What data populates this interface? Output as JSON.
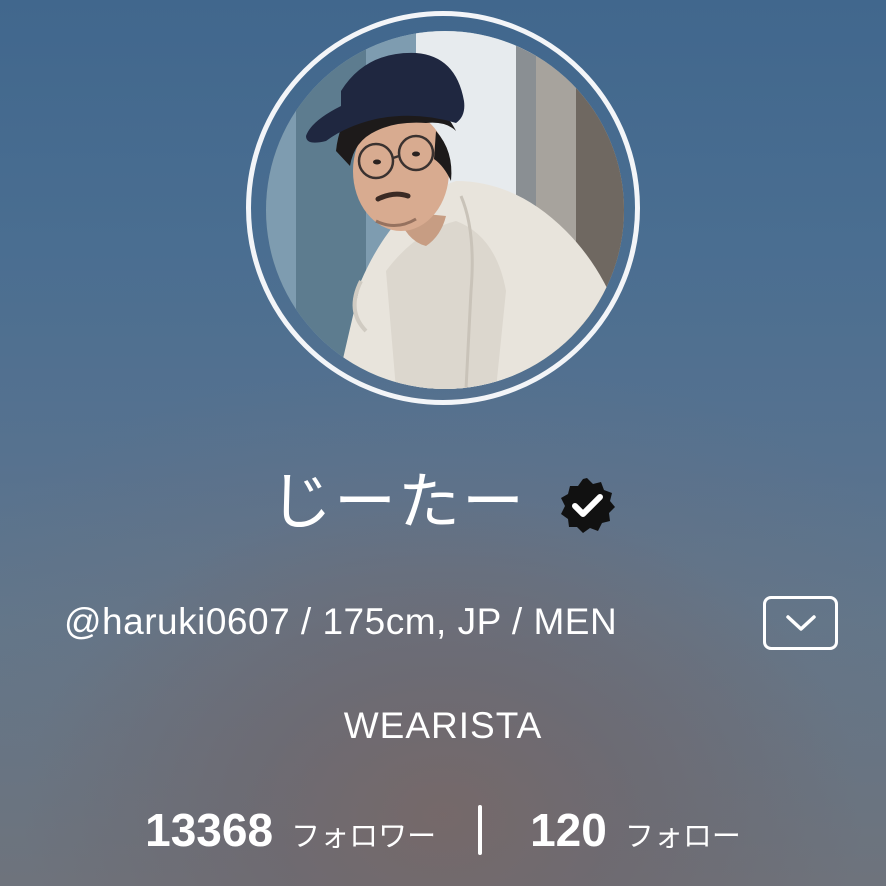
{
  "profile": {
    "display_name": "じーたー",
    "verified_icon": "verified-check-badge",
    "meta_line": "@haruki0607 / 175cm, JP / MEN",
    "expand_icon": "chevron-down-icon",
    "role": "WEARISTA"
  },
  "stats": {
    "followers_count": "13368",
    "followers_label": "フォロワー",
    "following_count": "120",
    "following_label": "フォロー"
  },
  "colors": {
    "background_top": "#41678d",
    "background_bottom": "#6e737c",
    "text": "#ffffff",
    "badge": "#111111"
  }
}
